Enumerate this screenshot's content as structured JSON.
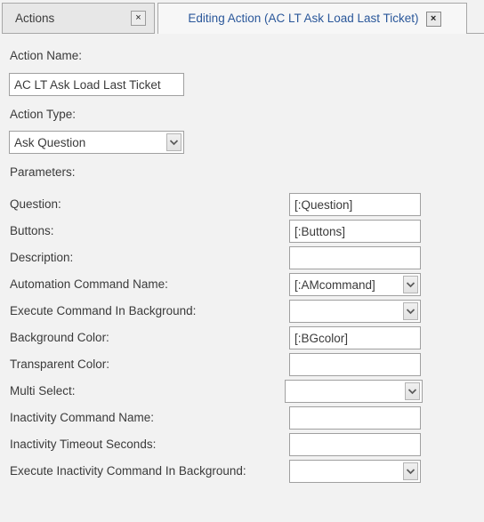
{
  "tabs": [
    {
      "label": "Actions",
      "close_label": "×",
      "active": false
    },
    {
      "label": "Editing Action (AC LT Ask Load Last Ticket)",
      "close_label": "×",
      "active": true
    }
  ],
  "form": {
    "action_name_label": "Action Name:",
    "action_name_value": "AC LT Ask Load Last Ticket",
    "action_type_label": "Action Type:",
    "action_type_value": "Ask Question",
    "parameters_label": "Parameters:"
  },
  "parameters": [
    {
      "label": "Question:",
      "value": "[:Question]",
      "control": "text"
    },
    {
      "label": "Buttons:",
      "value": "[:Buttons]",
      "control": "text"
    },
    {
      "label": "Description:",
      "value": "",
      "control": "text"
    },
    {
      "label": "Automation Command Name:",
      "value": "[:AMcommand]",
      "control": "combo"
    },
    {
      "label": "Execute Command In Background:",
      "value": "",
      "control": "combo"
    },
    {
      "label": "Background Color:",
      "value": "[:BGcolor]",
      "control": "text"
    },
    {
      "label": "Transparent Color:",
      "value": "",
      "control": "text"
    },
    {
      "label": "Multi Select:",
      "value": "",
      "control": "combo-wide"
    },
    {
      "label": "Inactivity Command Name:",
      "value": "",
      "control": "text"
    },
    {
      "label": "Inactivity Timeout Seconds:",
      "value": "",
      "control": "text"
    },
    {
      "label": "Execute Inactivity Command In Background:",
      "value": "",
      "control": "combo"
    }
  ],
  "colors": {
    "background": "#f2f2f2",
    "active_tab_text": "#2a579a",
    "border": "#a0a0a0",
    "text": "#3a3a3a"
  }
}
